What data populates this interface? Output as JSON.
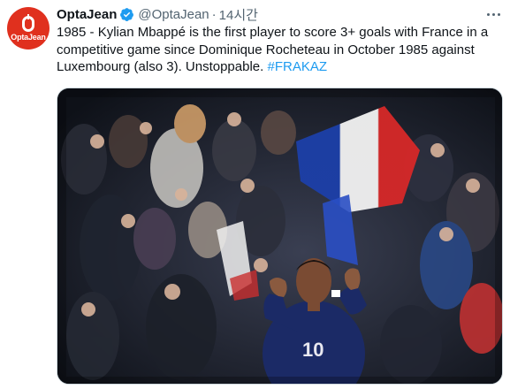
{
  "account": {
    "avatar_text": "OptaJean",
    "display_name": "OptaJean",
    "handle": "@OptaJean",
    "separator": "·",
    "time": "14시간"
  },
  "tweet": {
    "text": "1985 - Kylian Mbappé is the first player to score 3+ goals with France in a competitive game since Dominique Rocheteau in October 1985 against Luxembourg (also 3). Unstoppable. ",
    "hashtag": "#FRAKAZ"
  },
  "media": {
    "description_icon": "photo-football-celebration",
    "jersey_number": "10"
  },
  "colors": {
    "brand": "#e0301e",
    "link": "#1d9bf0",
    "verified": "#1d9bf0",
    "secondary_text": "#536471"
  }
}
